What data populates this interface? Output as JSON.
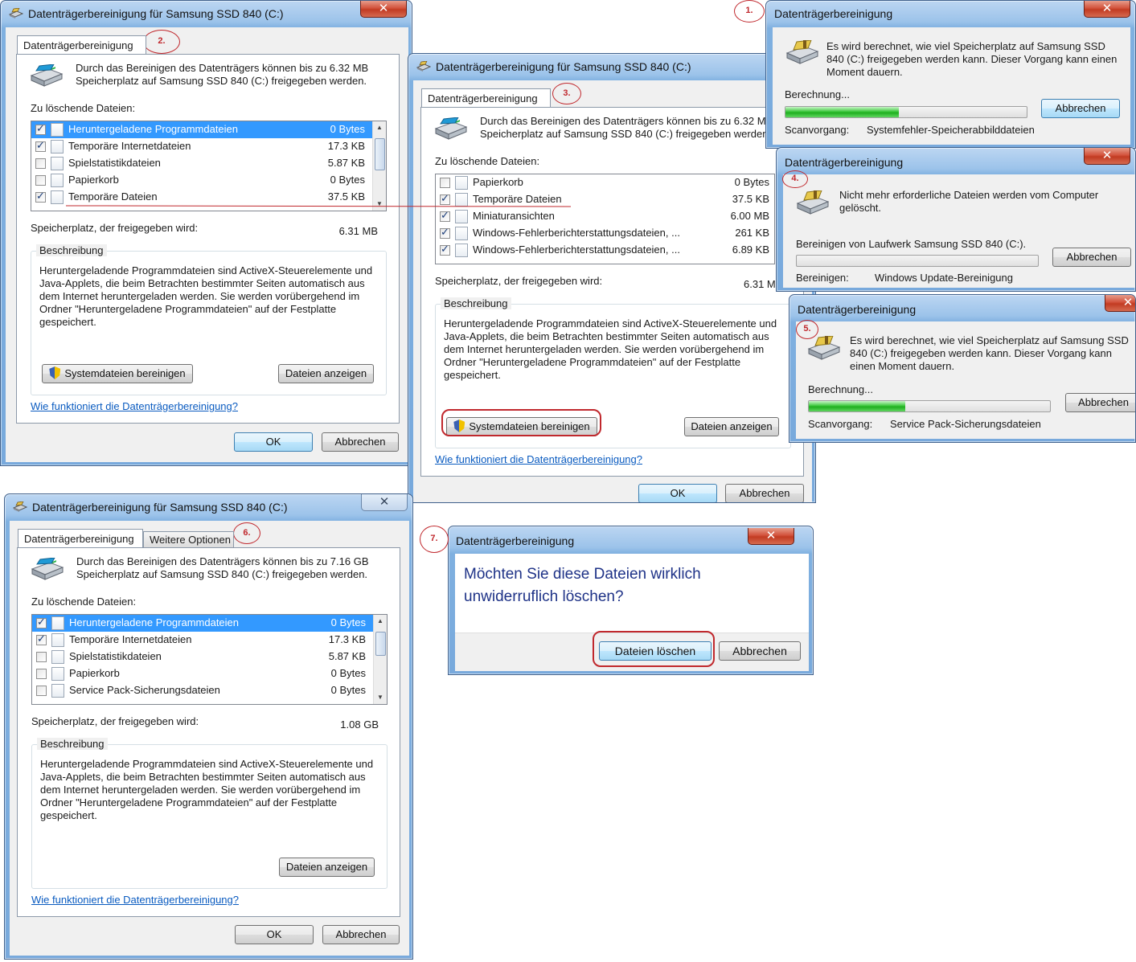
{
  "common": {
    "title_drive": "Datenträgerbereinigung für Samsung SSD 840 (C:)",
    "title_short": "Datenträgerbereinigung",
    "tab_main": "Datenträgerbereinigung",
    "tab_more": "Weitere Optionen",
    "files_label": "Zu löschende Dateien:",
    "space_label": "Speicherplatz, der freigegeben wird:",
    "desc_label": "Beschreibung",
    "desc_text": "Heruntergeladende Programmdateien sind ActiveX-Steuerelemente und Java-Applets, die beim Betrachten bestimmter Seiten automatisch aus dem Internet heruntergeladen werden. Sie werden vorübergehend im Ordner \"Heruntergeladene Programmdateien\" auf der Festplatte gespeichert.",
    "btn_system": "Systemdateien bereinigen",
    "btn_show": "Dateien anzeigen",
    "link_help": "Wie funktioniert die Datenträgerbereinigung?",
    "btn_ok": "OK",
    "btn_cancel": "Abbrechen",
    "close_glyph": "✕"
  },
  "annotations": {
    "a1": "1.",
    "a2": "2.",
    "a3": "3.",
    "a4": "4.",
    "a5": "5.",
    "a6": "6.",
    "a7": "7."
  },
  "w1": {
    "intro": "Durch das Bereinigen des Datenträgers können bis zu 6.32 MB Speicherplatz auf Samsung SSD 840 (C:) freigegeben werden.",
    "space_value": "6.31 MB",
    "files": [
      {
        "name": "Heruntergeladene Programmdateien",
        "size": "0 Bytes",
        "checked": true,
        "selected": true
      },
      {
        "name": "Temporäre Internetdateien",
        "size": "17.3 KB",
        "checked": true
      },
      {
        "name": "Spielstatistikdateien",
        "size": "5.87 KB",
        "checked": false
      },
      {
        "name": "Papierkorb",
        "size": "0 Bytes",
        "checked": false
      },
      {
        "name": "Temporäre Dateien",
        "size": "37.5 KB",
        "checked": true
      }
    ]
  },
  "w2": {
    "intro": "Durch das Bereinigen des Datenträgers können bis zu 6.32 MB Speicherplatz auf Samsung SSD 840 (C:) freigegeben werden.",
    "space_value": "6.31 M",
    "files": [
      {
        "name": "Papierkorb",
        "size": "0 Bytes",
        "checked": false
      },
      {
        "name": "Temporäre Dateien",
        "size": "37.5 KB",
        "checked": true
      },
      {
        "name": "Miniaturansichten",
        "size": "6.00 MB",
        "checked": true
      },
      {
        "name": "Windows-Fehlerberichterstattungsdateien, ...",
        "size": "261 KB",
        "checked": true
      },
      {
        "name": "Windows-Fehlerberichterstattungsdateien, ...",
        "size": "6.89 KB",
        "checked": true
      }
    ]
  },
  "p1": {
    "message": "Es wird berechnet, wie viel Speicherplatz auf Samsung SSD 840 (C:) freigegeben werden kann. Dieser Vorgang kann einen Moment dauern.",
    "status": "Berechnung...",
    "progress": 0.47,
    "scan_label": "Scanvorgang:",
    "scan_value": "Systemfehler-Speicherabbilddateien"
  },
  "p2": {
    "message": "Nicht mehr erforderliche Dateien werden vom Computer gelöscht.",
    "status": "Bereinigen von Laufwerk Samsung SSD 840 (C:).",
    "progress": 0.0,
    "scan_label": "Bereinigen:",
    "scan_value": "Windows Update-Bereinigung"
  },
  "p3": {
    "message": "Es wird berechnet, wie viel Speicherplatz auf Samsung SSD 840 (C:) freigegeben werden kann. Dieser Vorgang kann einen Moment dauern.",
    "status": "Berechnung...",
    "progress": 0.4,
    "scan_label": "Scanvorgang:",
    "scan_value": "Service Pack-Sicherungsdateien"
  },
  "w3": {
    "intro": "Durch das Bereinigen des Datenträgers können bis zu 7.16 GB Speicherplatz auf Samsung SSD 840 (C:) freigegeben werden.",
    "space_value": "1.08 GB",
    "files": [
      {
        "name": "Heruntergeladene Programmdateien",
        "size": "0 Bytes",
        "checked": true,
        "selected": true
      },
      {
        "name": "Temporäre Internetdateien",
        "size": "17.3 KB",
        "checked": true
      },
      {
        "name": "Spielstatistikdateien",
        "size": "5.87 KB",
        "checked": false
      },
      {
        "name": "Papierkorb",
        "size": "0 Bytes",
        "checked": false
      },
      {
        "name": "Service Pack-Sicherungsdateien",
        "size": "0 Bytes",
        "checked": false
      }
    ]
  },
  "confirm": {
    "question": "Möchten Sie diese Dateien wirklich unwiderruflich löschen?",
    "btn_delete": "Dateien löschen",
    "btn_cancel": "Abbrechen"
  }
}
